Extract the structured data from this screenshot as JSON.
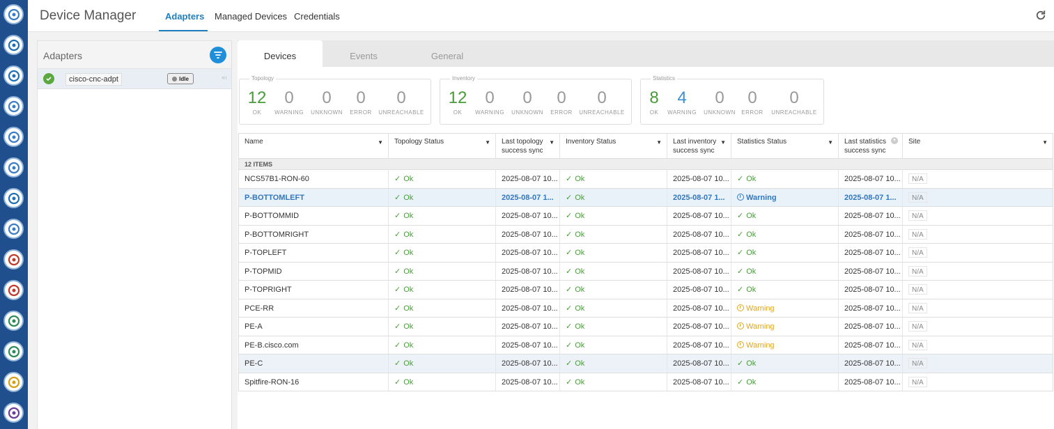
{
  "rail": {
    "icons": [
      "globe-icon",
      "gauge-icon",
      "sql-icon",
      "refresh-icon",
      "u-icon",
      "cloud-icon",
      "layers-icon",
      "trend-icon",
      "books-icon",
      "search-network-icon",
      "document-icon",
      "triangle-icon",
      "ring-icon",
      "zoom-icon"
    ]
  },
  "header": {
    "title": "Device Manager",
    "tabs": [
      {
        "label": "Adapters",
        "active": true
      },
      {
        "label": "Managed Devices",
        "active": false
      },
      {
        "label": "Credentials",
        "active": false
      }
    ]
  },
  "adapters": {
    "title": "Adapters",
    "items": [
      {
        "name": "cisco-cnc-adpt",
        "status": "Idle"
      }
    ]
  },
  "subtabs": [
    {
      "label": "Devices",
      "active": true
    },
    {
      "label": "Events",
      "active": false
    },
    {
      "label": "General",
      "active": false
    }
  ],
  "summary": {
    "topology": {
      "title": "Topology",
      "ok": "12",
      "warning": "0",
      "unknown": "0",
      "error": "0",
      "unreachable": "0"
    },
    "inventory": {
      "title": "Inventory",
      "ok": "12",
      "warning": "0",
      "unknown": "0",
      "error": "0",
      "unreachable": "0"
    },
    "statistics": {
      "title": "Statistics",
      "ok": "8",
      "warning": "4",
      "unknown": "0",
      "error": "0",
      "unreachable": "0"
    },
    "labels": {
      "ok": "OK",
      "warning": "WARNING",
      "unknown": "UNKNOWN",
      "error": "ERROR",
      "unreachable": "UNREACHABLE"
    }
  },
  "table": {
    "columns": {
      "name": "Name",
      "topology_status": "Topology Status",
      "last_topology_1": "Last topology",
      "last_topology_2": "success sync",
      "inventory_status": "Inventory Status",
      "last_inventory_1": "Last inventory",
      "last_inventory_2": "success sync",
      "statistics_status": "Statistics Status",
      "last_statistics_1": "Last statistics",
      "last_statistics_2": "success sync",
      "site": "Site"
    },
    "group_label": "12 ITEMS",
    "rows": [
      {
        "name": "NCS57B1-RON-60",
        "topo": "Ok",
        "topo_date": "2025-08-07 10...",
        "inv": "Ok",
        "inv_date": "2025-08-07 10...",
        "stats": "Ok",
        "stats_date": "2025-08-07 10...",
        "site": "N/A"
      },
      {
        "name": "P-BOTTOMLEFT",
        "topo": "Ok",
        "topo_date": "2025-08-07 1...",
        "inv": "Ok",
        "inv_date": "2025-08-07 1...",
        "stats": "Warning",
        "stats_date": "2025-08-07 1...",
        "site": "N/A"
      },
      {
        "name": "P-BOTTOMMID",
        "topo": "Ok",
        "topo_date": "2025-08-07 10...",
        "inv": "Ok",
        "inv_date": "2025-08-07 10...",
        "stats": "Ok",
        "stats_date": "2025-08-07 10...",
        "site": "N/A"
      },
      {
        "name": "P-BOTTOMRIGHT",
        "topo": "Ok",
        "topo_date": "2025-08-07 10...",
        "inv": "Ok",
        "inv_date": "2025-08-07 10...",
        "stats": "Ok",
        "stats_date": "2025-08-07 10...",
        "site": "N/A"
      },
      {
        "name": "P-TOPLEFT",
        "topo": "Ok",
        "topo_date": "2025-08-07 10...",
        "inv": "Ok",
        "inv_date": "2025-08-07 10...",
        "stats": "Ok",
        "stats_date": "2025-08-07 10...",
        "site": "N/A"
      },
      {
        "name": "P-TOPMID",
        "topo": "Ok",
        "topo_date": "2025-08-07 10...",
        "inv": "Ok",
        "inv_date": "2025-08-07 10...",
        "stats": "Ok",
        "stats_date": "2025-08-07 10...",
        "site": "N/A"
      },
      {
        "name": "P-TOPRIGHT",
        "topo": "Ok",
        "topo_date": "2025-08-07 10...",
        "inv": "Ok",
        "inv_date": "2025-08-07 10...",
        "stats": "Ok",
        "stats_date": "2025-08-07 10...",
        "site": "N/A"
      },
      {
        "name": "PCE-RR",
        "topo": "Ok",
        "topo_date": "2025-08-07 10...",
        "inv": "Ok",
        "inv_date": "2025-08-07 10...",
        "stats": "Warning",
        "stats_date": "2025-08-07 10...",
        "site": "N/A"
      },
      {
        "name": "PE-A",
        "topo": "Ok",
        "topo_date": "2025-08-07 10...",
        "inv": "Ok",
        "inv_date": "2025-08-07 10...",
        "stats": "Warning",
        "stats_date": "2025-08-07 10...",
        "site": "N/A"
      },
      {
        "name": "PE-B.cisco.com",
        "topo": "Ok",
        "topo_date": "2025-08-07 10...",
        "inv": "Ok",
        "inv_date": "2025-08-07 10...",
        "stats": "Warning",
        "stats_date": "2025-08-07 10...",
        "site": "N/A"
      },
      {
        "name": "PE-C",
        "topo": "Ok",
        "topo_date": "2025-08-07 10...",
        "inv": "Ok",
        "inv_date": "2025-08-07 10...",
        "stats": "Ok",
        "stats_date": "2025-08-07 10...",
        "site": "N/A"
      },
      {
        "name": "Spitfire-RON-16",
        "topo": "Ok",
        "topo_date": "2025-08-07 10...",
        "inv": "Ok",
        "inv_date": "2025-08-07 10...",
        "stats": "Ok",
        "stats_date": "2025-08-07 10...",
        "site": "N/A"
      }
    ],
    "selected_row": 1,
    "hover_row": 10
  },
  "colors": {
    "rail": "#1f4f8c",
    "accent": "#1f7fbf",
    "ok": "#4a9a3c",
    "warning": "#e3a51a"
  }
}
